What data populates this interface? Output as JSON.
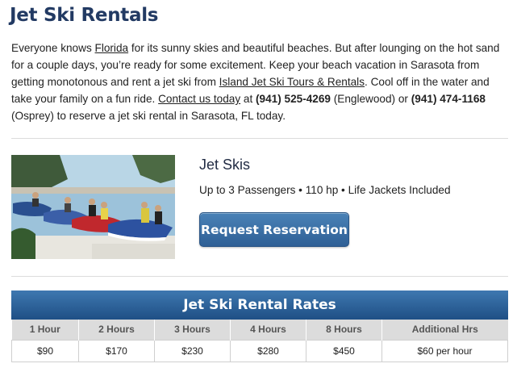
{
  "page": {
    "title": "Jet Ski Rentals"
  },
  "intro": {
    "p1": "Everyone knows ",
    "link_florida": "Florida",
    "p2": " for its sunny skies and beautiful beaches. But after lounging on the hot sand for a couple days, you’re ready for some excitement. Keep your beach vacation in Sarasota from getting monotonous and rent a jet ski from ",
    "link_company": "Island Jet Ski Tours & Rentals",
    "p3": ". Cool off in the water and take your family on a fun ride. ",
    "link_contact": "Contact us today",
    "p4": " at ",
    "phone1": "(941) 525-4269",
    "p5": " (Englewood) or ",
    "phone2": "(941) 474-1168",
    "p6": " (Osprey) to reserve a jet ski rental in Sarasota, FL today."
  },
  "product": {
    "title": "Jet Skis",
    "description": "Up to 3 Passengers • 110 hp • Life Jackets Included",
    "button_label": "Request Reservation"
  },
  "rates": {
    "title": "Jet Ski Rental Rates",
    "headers": [
      "1 Hour",
      "2 Hours",
      "3 Hours",
      "4 Hours",
      "8 Hours",
      "Additional Hrs"
    ],
    "values": [
      "$90",
      "$170",
      "$230",
      "$280",
      "$450",
      "$60 per hour"
    ]
  },
  "colors": {
    "title": "#223a63",
    "button": "#3a6ea5",
    "rates_header": "#2d62a0",
    "table_header_bg": "#dcdcdc"
  }
}
